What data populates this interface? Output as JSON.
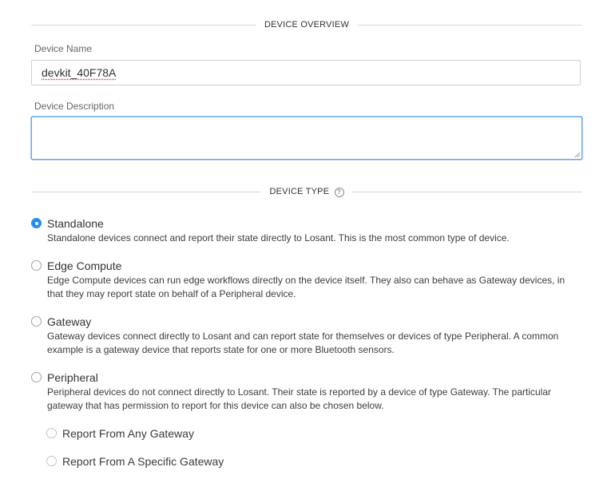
{
  "overview": {
    "section_title": "DEVICE OVERVIEW",
    "name_label": "Device Name",
    "name_value": "devkit_40F78A",
    "description_label": "Device Description",
    "description_value": ""
  },
  "device_type": {
    "section_title": "DEVICE TYPE",
    "help_icon": "question-circle-icon",
    "selected": "Standalone",
    "options": [
      {
        "title": "Standalone",
        "description": "Standalone devices connect and report their state directly to Losant. This is the most common type of device."
      },
      {
        "title": "Edge Compute",
        "description": "Edge Compute devices can run edge workflows directly on the device itself. They also can behave as Gateway devices, in that they may report state on behalf of a Peripheral device."
      },
      {
        "title": "Gateway",
        "description": "Gateway devices connect directly to Losant and can report state for themselves or devices of type Peripheral. A common example is a gateway device that reports state for one or more Bluetooth sensors."
      },
      {
        "title": "Peripheral",
        "description": "Peripheral devices do not connect directly to Losant. Their state is reported by a device of type Gateway. The particular gateway that has permission to report for this device can also be chosen below."
      }
    ],
    "peripheral_sub_options": [
      {
        "title": "Report From Any Gateway"
      },
      {
        "title": "Report From A Specific Gateway"
      }
    ]
  },
  "colors": {
    "accent": "#1f8ff0",
    "focus_border": "#6aa7e8",
    "divider": "#d9d9d9"
  }
}
